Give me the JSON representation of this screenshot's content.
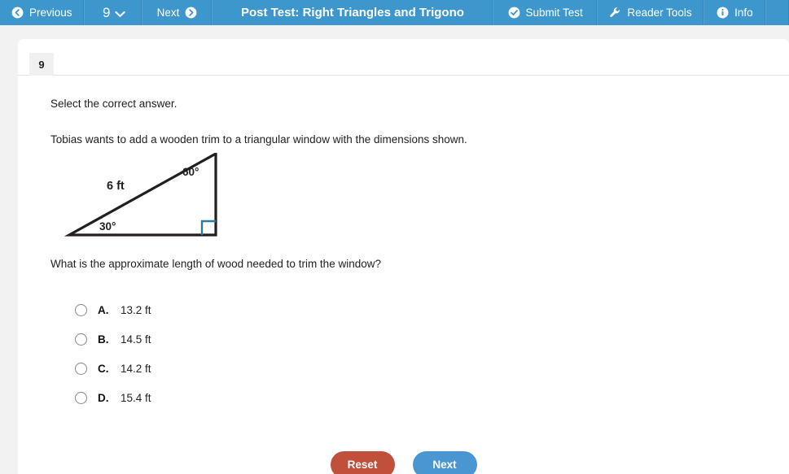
{
  "topbar": {
    "previous_label": "Previous",
    "question_number": "9",
    "next_label": "Next",
    "title": "Post Test: Right Triangles and Trigono",
    "submit_label": "Submit Test",
    "reader_tools_label": "Reader Tools",
    "info_label": "Info",
    "background_color": "#3e97cc"
  },
  "question": {
    "tab_number": "9",
    "instruction": "Select the correct answer.",
    "stem": "Tobias wants to add a wooden trim to a triangular window with the dimensions shown.",
    "prompt": "What is the approximate length of wood needed to trim the window?",
    "figure": {
      "type": "right-triangle",
      "hypotenuse_label": "6 ft",
      "angle_top_label": "60°",
      "angle_bottom_label": "30°",
      "right_angle_marker_color": "#2d7ba5",
      "stroke_color": "#231f20"
    },
    "choices": [
      {
        "letter": "A.",
        "text": "13.2 ft",
        "selected": false
      },
      {
        "letter": "B.",
        "text": "14.5 ft",
        "selected": false
      },
      {
        "letter": "C.",
        "text": "14.2 ft",
        "selected": false
      },
      {
        "letter": "D.",
        "text": "15.4 ft",
        "selected": false
      }
    ]
  },
  "actions": {
    "reset_label": "Reset",
    "reset_color": "#c0503c",
    "next_label": "Next",
    "next_color": "#4a96d2"
  }
}
